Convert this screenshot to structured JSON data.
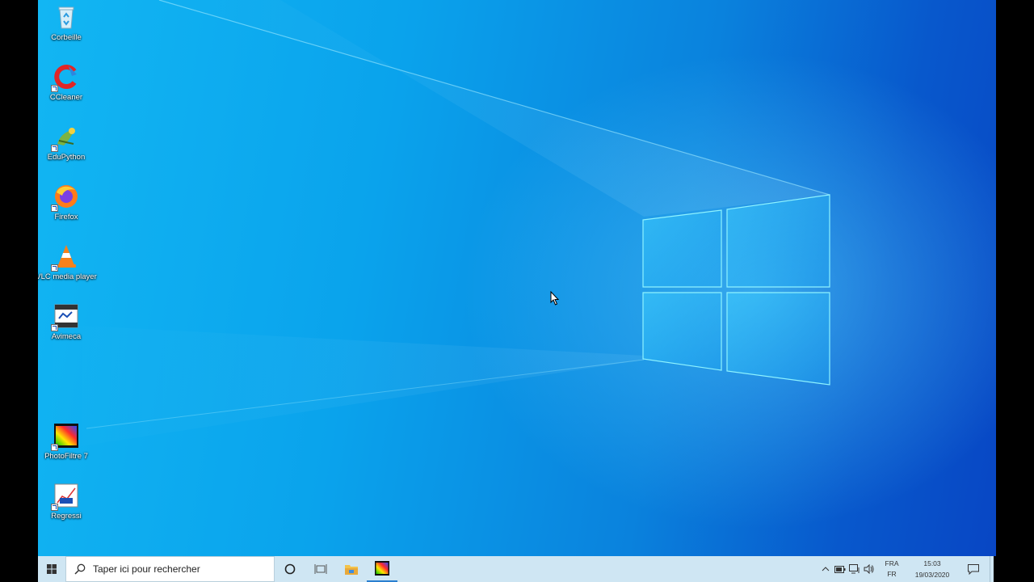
{
  "desktop": {
    "icons": [
      {
        "label": "Corbeille",
        "icon": "recycle-bin-icon"
      },
      {
        "label": "CCleaner",
        "icon": "ccleaner-icon"
      },
      {
        "label": "EduPython",
        "icon": "edupython-icon"
      },
      {
        "label": "Firefox",
        "icon": "firefox-icon"
      },
      {
        "label": "VLC media player",
        "icon": "vlc-icon"
      },
      {
        "label": "Avimeca",
        "icon": "avimeca-icon"
      },
      {
        "label": "PhotoFiltre 7",
        "icon": "photofiltre-icon"
      },
      {
        "label": "Regressi",
        "icon": "regressi-icon"
      }
    ]
  },
  "taskbar": {
    "search_placeholder": "Taper ici pour rechercher",
    "pinned": [
      "cortana-icon",
      "task-view-icon",
      "file-explorer-icon",
      "photofiltre-icon"
    ],
    "tray": {
      "language_top": "FRA",
      "language_bottom": "FR",
      "time": "15:03",
      "date": "19/03/2020"
    }
  },
  "colors": {
    "wallpaper_accent": "#0aa3ec",
    "taskbar_bg": "#cfe6f3"
  }
}
